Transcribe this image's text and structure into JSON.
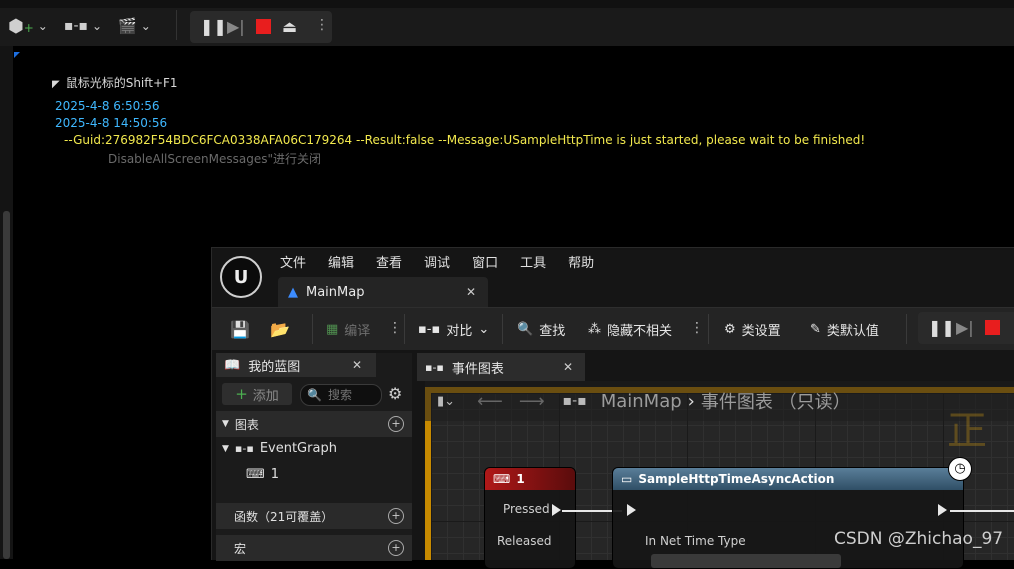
{
  "log": {
    "hint": "鼠标光标的Shift+F1",
    "timestamp1": "2025-4-8  6:50:56",
    "timestamp2": "2025-4-8  14:50:56",
    "message": "--Guid:276982F54BDC6FCA0338AFA06C179264   --Result:false   --Message:USampleHttpTime is just started, please wait to be finished!",
    "faded": "DisableAllScreenMessages\"进行关闭"
  },
  "editor": {
    "logo": "U",
    "menu": [
      "文件",
      "编辑",
      "查看",
      "调试",
      "窗口",
      "工具",
      "帮助"
    ],
    "doc_tab": "MainMap",
    "toolbar": {
      "compile": "编译",
      "diff": "对比",
      "find": "查找",
      "hide_unrelated": "隐藏不相关",
      "class_settings": "类设置",
      "class_defaults": "类默认值"
    },
    "my_blueprint": {
      "tab": "我的蓝图",
      "add": "添加",
      "search_placeholder": "搜索",
      "graphs": "图表",
      "event_graph": "EventGraph",
      "event_item": "1",
      "functions": "函数（21可覆盖）",
      "macros": "宏"
    },
    "graph": {
      "tab": "事件图表",
      "breadcrumb_root": "MainMap",
      "breadcrumb_leaf": "事件图表 （只读）",
      "watermark": "正",
      "node_key": {
        "title": "1",
        "pin_pressed": "Pressed",
        "pin_released": "Released"
      },
      "node_async": {
        "title": "SampleHttpTimeAsyncAction",
        "pin_in": "In Net Time Type"
      }
    }
  },
  "watermark_text": "CSDN @Zhichao_97"
}
